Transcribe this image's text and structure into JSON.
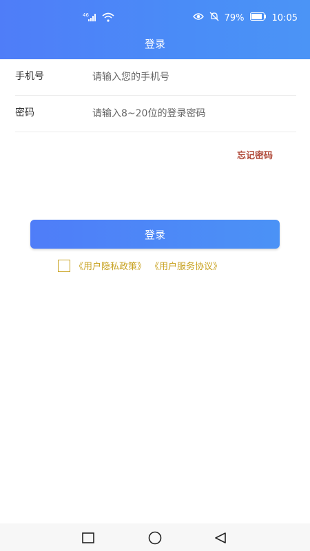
{
  "status_bar": {
    "battery_percent": "79%",
    "time": "10:05"
  },
  "header": {
    "title": "登录"
  },
  "form": {
    "phone": {
      "label": "手机号",
      "placeholder": "请输入您的手机号",
      "value": ""
    },
    "password": {
      "label": "密码",
      "placeholder": "请输入8~20位的登录密码",
      "value": ""
    }
  },
  "forgot_label": "忘记密码",
  "login_button_label": "登录",
  "agreement": {
    "privacy_label": "《用户隐私政策》",
    "service_label": "《用户服务协议》",
    "checked": false
  },
  "colors": {
    "header_start": "#4f7df8",
    "header_end": "#4b94f6",
    "forgot": "#b04a3a",
    "agreement": "#c8a220"
  },
  "icons": {
    "status_left": [
      "signal-icon",
      "wifi-icon"
    ],
    "status_right": [
      "eye-icon",
      "mute-icon",
      "battery-icon"
    ],
    "nav": [
      "recent-apps-icon",
      "home-icon",
      "back-icon"
    ]
  }
}
